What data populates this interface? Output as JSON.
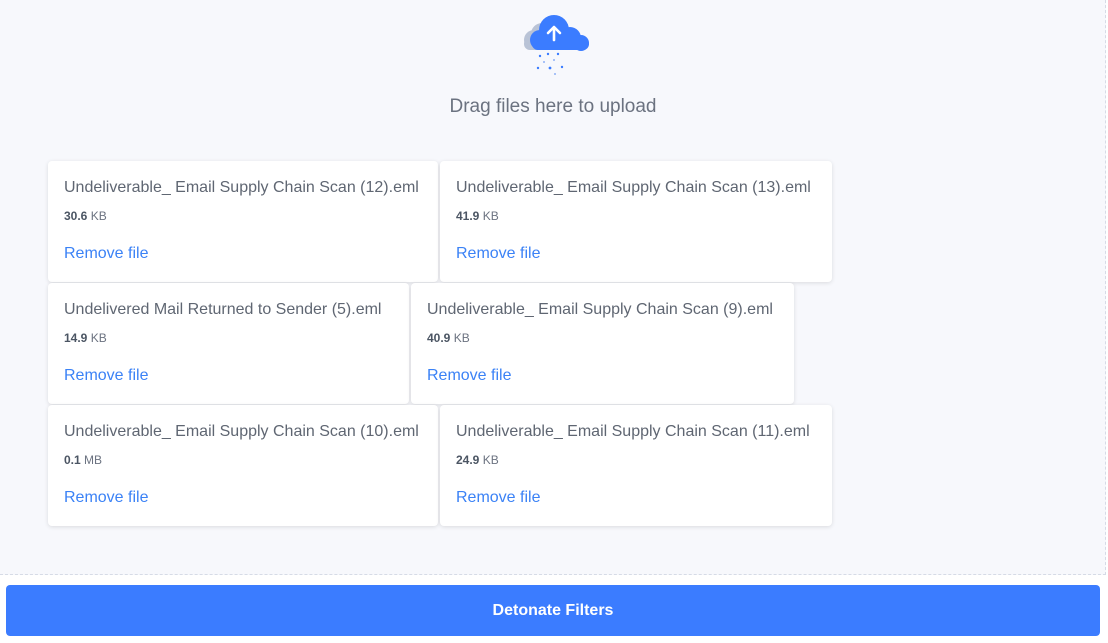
{
  "dropzone": {
    "message": "Drag files here to upload",
    "icon": "cloud-upload-icon",
    "accent_color": "#3b7cff"
  },
  "files": [
    {
      "name": "Undeliverable_ Email Supply Chain Scan (12).eml",
      "size_value": "30.6",
      "size_unit": "KB",
      "remove_label": "Remove file"
    },
    {
      "name": "Undeliverable_ Email Supply Chain Scan (13).eml",
      "size_value": "41.9",
      "size_unit": "KB",
      "remove_label": "Remove file"
    },
    {
      "name": "Undelivered Mail Returned to Sender (5).eml",
      "size_value": "14.9",
      "size_unit": "KB",
      "remove_label": "Remove file"
    },
    {
      "name": "Undeliverable_ Email Supply Chain Scan (9).eml",
      "size_value": "40.9",
      "size_unit": "KB",
      "remove_label": "Remove file"
    },
    {
      "name": "Undeliverable_ Email Supply Chain Scan (10).eml",
      "size_value": "0.1",
      "size_unit": "MB",
      "remove_label": "Remove file"
    },
    {
      "name": "Undeliverable_ Email Supply Chain Scan (11).eml",
      "size_value": "24.9",
      "size_unit": "KB",
      "remove_label": "Remove file"
    }
  ],
  "actions": {
    "detonate_label": "Detonate Filters"
  }
}
